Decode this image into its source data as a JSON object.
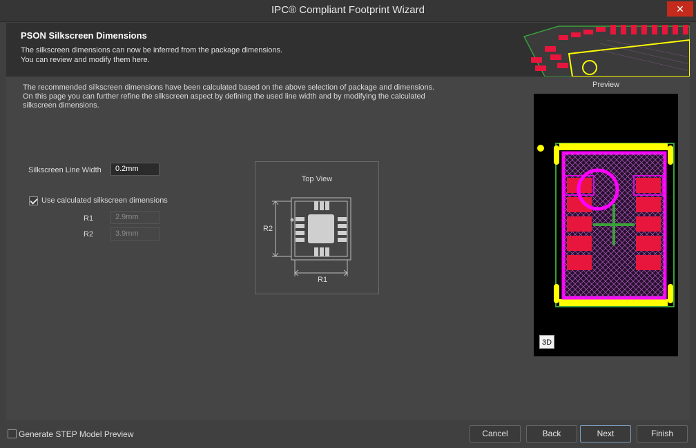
{
  "window": {
    "title": "IPC® Compliant Footprint Wizard",
    "close_glyph": "✕"
  },
  "header": {
    "title": "PSON Silkscreen Dimensions",
    "description": "The silkscreen dimensions can now be inferred from the package dimensions.\nYou can review and modify them here."
  },
  "main": {
    "intro": "The recommended silkscreen dimensions have been calculated based on the above selection of package and dimensions.\nOn this page you can further refine the silkscreen aspect by defining the used line width and by modifying the calculated\nsilkscreen dimensions.",
    "line_width_label": "Silkscreen Line Width",
    "line_width_value": "0.2mm",
    "use_calculated_label": "Use calculated silkscreen dimensions",
    "use_calculated_checked": true,
    "r1_label": "R1",
    "r1_value": "2.9mm",
    "r2_label": "R2",
    "r2_value": "3.9mm"
  },
  "top_view": {
    "title": "Top View",
    "r1_label": "R1",
    "r2_label": "R2"
  },
  "preview": {
    "label": "Preview",
    "btn_3d": "3D"
  },
  "footer": {
    "step_label": "Generate STEP Model Preview",
    "step_checked": false,
    "cancel": "Cancel",
    "back": "Back",
    "next": "Next",
    "finish": "Finish"
  },
  "colors": {
    "pad_red": "#e8163c",
    "silk_yellow": "#ffff00",
    "courtyard_magenta": "#ff00ff",
    "outline_green": "#3aa13a",
    "close_red": "#c42b1c"
  }
}
